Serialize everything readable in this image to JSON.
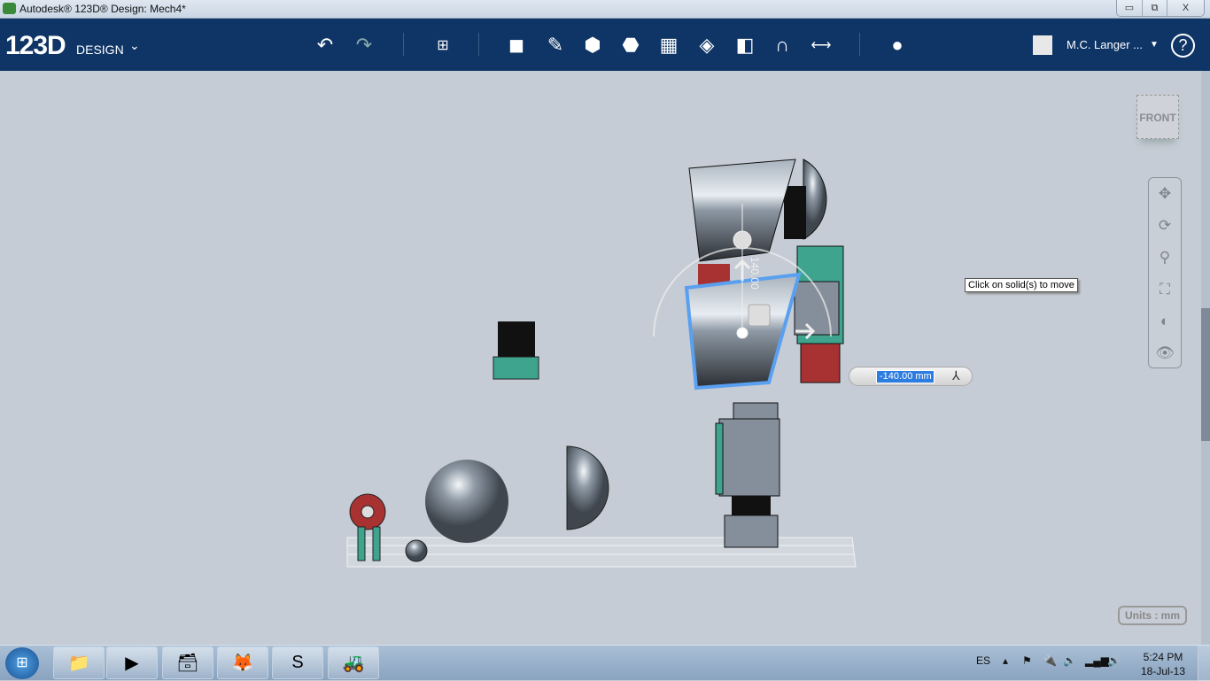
{
  "window": {
    "title": "Autodesk® 123D® Design: Mech4*",
    "controls": [
      "▭",
      "⧉",
      "X"
    ]
  },
  "toolbar": {
    "logo": "123D",
    "logo_sub": "DESIGN",
    "user": "M.C. Langer ...",
    "help": "?"
  },
  "viewcube": {
    "label": "FRONT"
  },
  "tooltip": "Click on solid(s) to move",
  "gizmo": {
    "value": "-140.00 mm",
    "ruler_label": "140.00"
  },
  "units": "Units : mm",
  "taskbar": {
    "lang": "ES",
    "time": "5:24 PM",
    "date": "18-Jul-13"
  },
  "colors": {
    "toolbar": "#0e3566",
    "canvas": "#c6ccd5",
    "selection": "#5aa0f0"
  }
}
